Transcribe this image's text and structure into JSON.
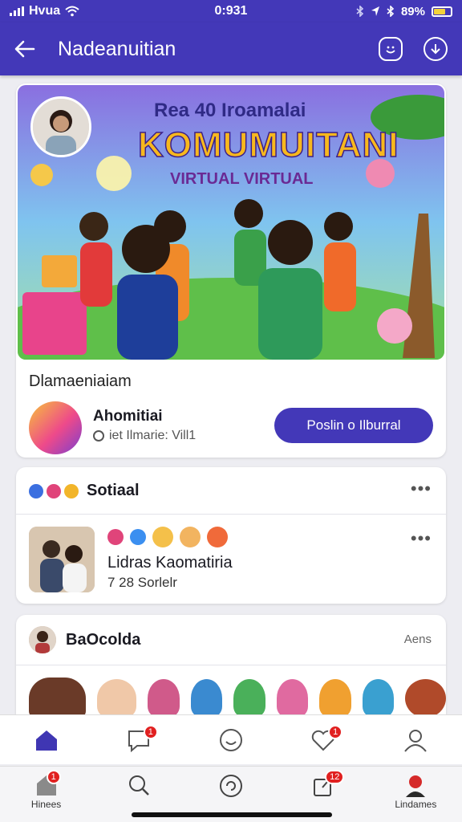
{
  "status_bar": {
    "carrier": "Hvua",
    "time": "0:931",
    "battery": "89%"
  },
  "app_bar": {
    "title": "Nadeanuitian"
  },
  "hero": {
    "line1": "Rea 40 Iroamalai",
    "line2": "KOMUMUITANI",
    "line3": "VIRTUAL VIRTUAL",
    "section_label": "Dlamaeniaiam",
    "group_name": "Ahomitiai",
    "group_meta": "iet Ilmarie: Vill1",
    "join_label": "Poslin o Ilburral"
  },
  "social": {
    "title": "Sotiaal",
    "post_title": "Lidras Kaomatiria",
    "post_meta": "7 28 Sorlelr"
  },
  "friends": {
    "title": "BaOcolda",
    "count": "Aens"
  },
  "nav": {
    "badges": {
      "messages": "1",
      "likes": "1",
      "home": "1",
      "share": "12"
    },
    "home_label": "Hinees",
    "profile_label": "Lindames"
  },
  "colors": {
    "primary": "#4338b8",
    "badge": "#e12020",
    "accent": "#f7b81e"
  }
}
